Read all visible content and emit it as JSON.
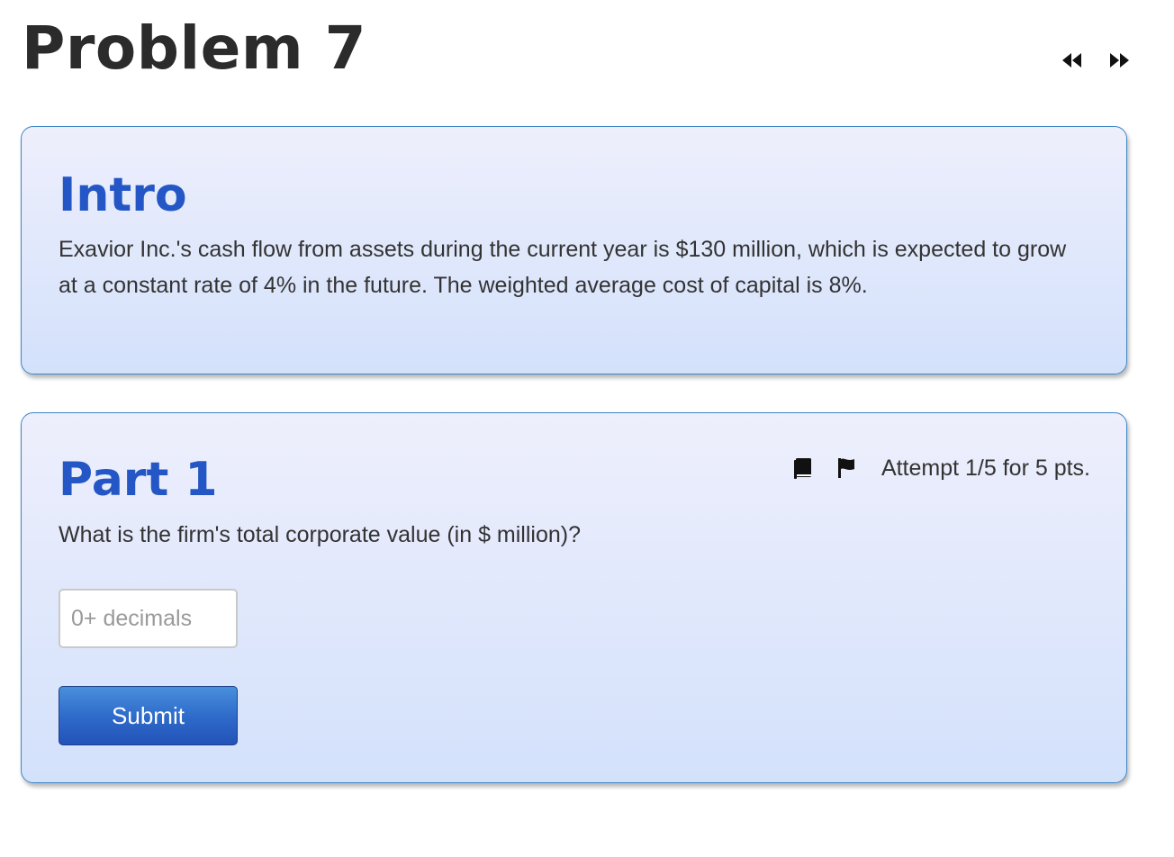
{
  "problem": {
    "title": "Problem 7"
  },
  "navigation": {
    "prev_icon": "double-chevron-left-icon",
    "next_icon": "double-chevron-right-icon"
  },
  "intro": {
    "heading": "Intro",
    "text": "Exavior Inc.'s cash flow from assets during the current year is $130 million, which is expected to grow at a constant rate of 4% in the future. The weighted average cost of capital is 8%."
  },
  "part1": {
    "heading": "Part 1",
    "attempt_text": "Attempt 1/5 for 5 pts.",
    "question": "What is the firm's total corporate value (in $ million)?",
    "input": {
      "value": "",
      "placeholder": "0+ decimals"
    },
    "submit_label": "Submit",
    "icons": {
      "book": "book-icon",
      "flag": "flag-icon"
    }
  },
  "colors": {
    "heading_blue": "#2457c5",
    "card_border": "#3d86c6",
    "card_top": "#eeeffc",
    "card_bottom": "#d3e1fb",
    "button_blue": "#2f6ccb"
  }
}
